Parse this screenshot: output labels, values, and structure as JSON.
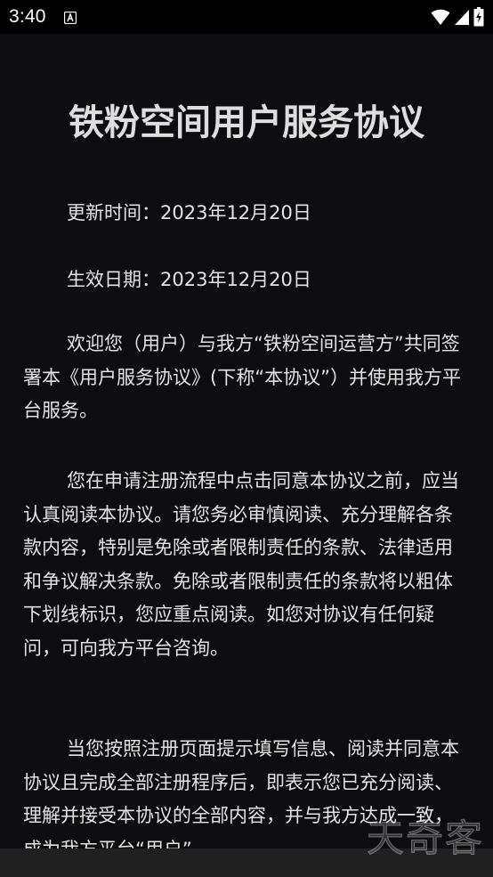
{
  "status_bar": {
    "time": "3:40"
  },
  "document": {
    "title": "铁粉空间用户服务协议",
    "updated": "更新时间：2023年12月20日",
    "effective": "生效日期：2023年12月20日",
    "paragraphs": [
      "欢迎您（用户）与我方“铁粉空间运营方”共同签署本《用户服务协议》(下称“本协议”）并使用我方平台服务。",
      "您在申请注册流程中点击同意本协议之前，应当认真阅读本协议。请您务必审慎阅读、充分理解各条款内容，特别是免除或者限制责任的条款、法律适用和争议解决条款。免除或者限制责任的条款将以粗体下划线标识，您应重点阅读。如您对协议有任何疑问，可向我方平台咨询。",
      "当您按照注册页面提示填写信息、阅读并同意本协议且完成全部注册程序后，即表示您已充分阅读、理解并接受本协议的全部内容，并与我方达成一致，成为我方平台“用户”"
    ]
  },
  "watermark": "天奇客",
  "colors": {
    "background": "#0d0c10",
    "text": "#e4e4e4",
    "title": "#dedede",
    "status_bar": "#000000",
    "nav_bar": "#202020"
  },
  "icons": {
    "notification": "font-a-notification-icon",
    "wifi": "wifi-icon",
    "signal": "cell-signal-icon",
    "battery": "battery-charging-icon"
  }
}
